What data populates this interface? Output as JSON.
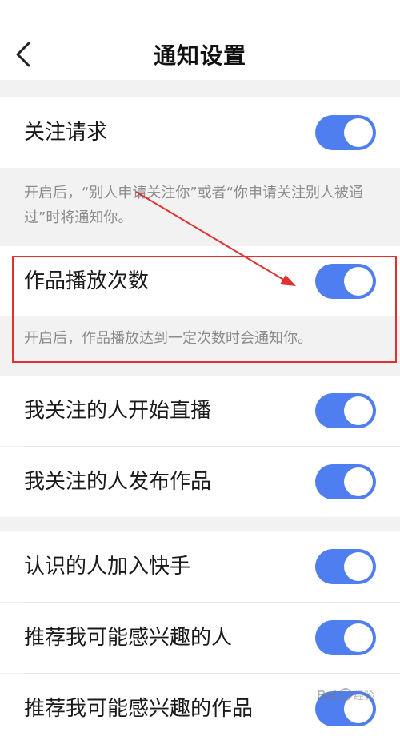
{
  "header": {
    "title": "通知设置"
  },
  "sections": {
    "follow_request": {
      "label": "关注请求",
      "enabled": true,
      "desc": "开启后，“别人申请关注你”或者“你申请关注别人被通过”时将通知你。"
    },
    "play_count": {
      "label": "作品播放次数",
      "enabled": true,
      "desc": "开启后，作品播放达到一定次数时会通知你。"
    },
    "following": [
      {
        "label": "我关注的人开始直播",
        "enabled": true
      },
      {
        "label": "我关注的人发布作品",
        "enabled": true
      }
    ],
    "recommend": [
      {
        "label": "认识的人加入快手",
        "enabled": true
      },
      {
        "label": "推荐我可能感兴趣的人",
        "enabled": true
      },
      {
        "label": "推荐我可能感兴趣的作品",
        "enabled": true
      }
    ]
  },
  "watermark": {
    "text": "Baidu 经验"
  },
  "colors": {
    "toggle_on": "#4f7ef0",
    "annotation": "#e0302f",
    "background": "#f2f2f2"
  }
}
